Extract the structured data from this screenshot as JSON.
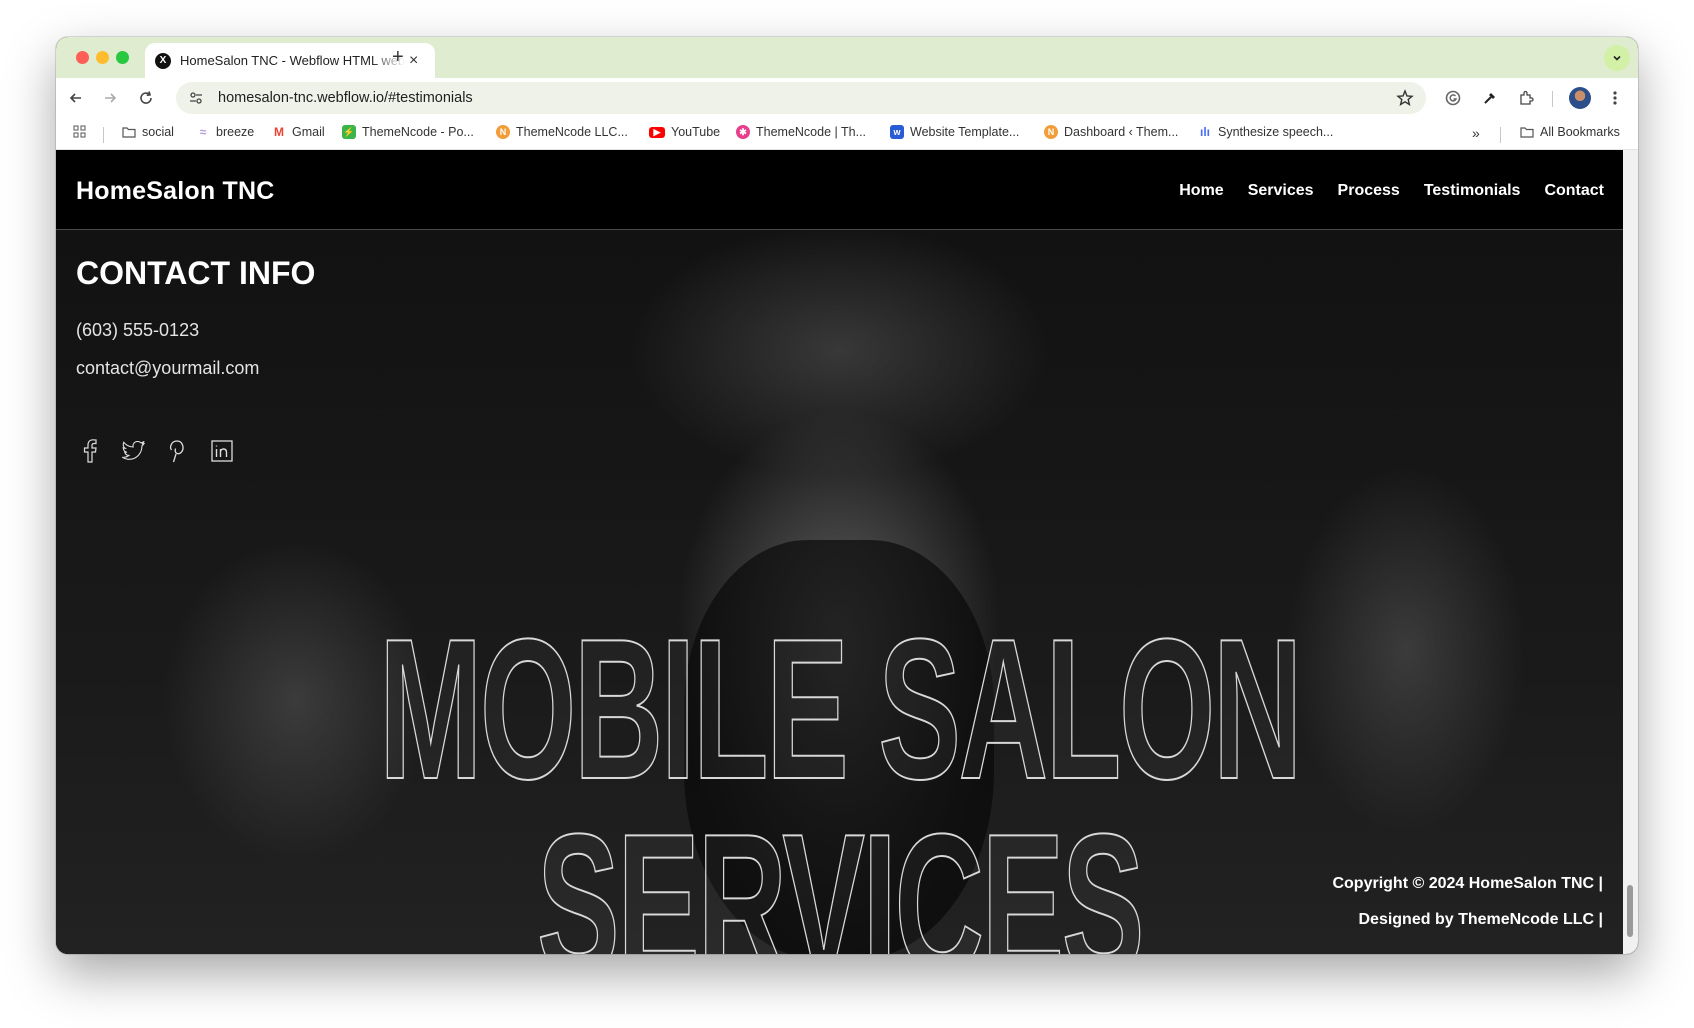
{
  "browser": {
    "tab_title": "HomeSalon TNC - Webflow HTML website template",
    "tab_favicon": "X",
    "url": "homesalon-tnc.webflow.io/#testimonials",
    "bookmarks": [
      {
        "label": "social",
        "icon": "folder-icon"
      },
      {
        "label": "breeze",
        "icon": "breeze-icon"
      },
      {
        "label": "Gmail",
        "icon": "gmail-icon"
      },
      {
        "label": "ThemeNcode - Po...",
        "icon": "themencode-green-icon"
      },
      {
        "label": "ThemeNcode LLC...",
        "icon": "themencode-orange-icon"
      },
      {
        "label": "YouTube",
        "icon": "youtube-icon"
      },
      {
        "label": "ThemeNcode | Th...",
        "icon": "themencode-pink-icon"
      },
      {
        "label": "Website Template...",
        "icon": "webflow-icon"
      },
      {
        "label": "Dashboard ‹ Them...",
        "icon": "dashboard-icon"
      },
      {
        "label": "Synthesize speech...",
        "icon": "speech-icon"
      }
    ],
    "all_bookmarks": "All Bookmarks",
    "colors": {
      "tabstrip": "#dfeccf",
      "accent": "#d2f0a6"
    }
  },
  "site": {
    "logo": "HomeSalon TNC",
    "nav": [
      "Home",
      "Services",
      "Process",
      "Testimonials",
      "Contact"
    ],
    "contact": {
      "title": "CONTACT INFO",
      "phone": "(603) 555-0123",
      "email": "contact@yourmail.com"
    },
    "socials": [
      "facebook-icon",
      "twitter-icon",
      "pinterest-icon",
      "linkedin-icon"
    ],
    "hero": {
      "line1": "MOBILE SALON",
      "line2": "SERVICES"
    },
    "footer": {
      "copyright": "Copyright © 2024 HomeSalon TNC |",
      "designed": "Designed by ThemeNcode LLC |"
    }
  }
}
